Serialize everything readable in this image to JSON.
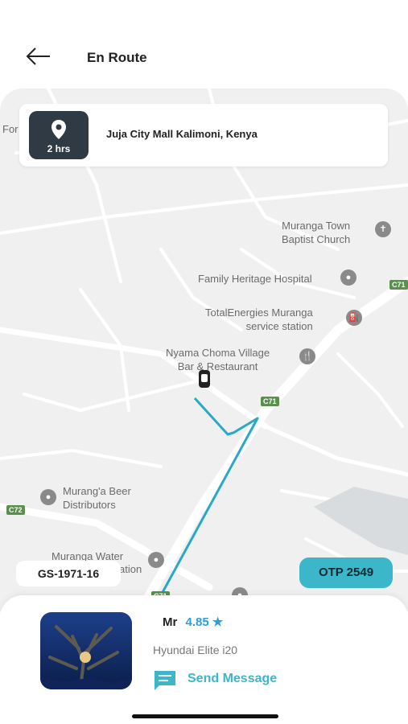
{
  "header": {
    "title": "En Route",
    "back_icon": "arrow-left-icon"
  },
  "destination": {
    "eta": "2 hrs",
    "address": "Juja City Mall Kalimoni, Kenya",
    "icon": "location-pin-icon"
  },
  "map": {
    "labels": {
      "for": "For",
      "baptist": "Muranga Town\nBaptist Church",
      "hospital": "Family Heritage Hospital",
      "total": "TotalEnergies Muranga\nservice station",
      "nyama": "Nyama Choma Village\nBar & Restaurant",
      "beer": "Murang'a Beer\nDistributors",
      "water": "Muranga Water",
      "water2": "ation"
    },
    "roads": {
      "c71_a": "C71",
      "c71_b": "C71",
      "c72": "C72",
      "c71_c": "C71"
    },
    "route_color": "#29a9c6"
  },
  "vehicle": {
    "plate": "GS-1971-16"
  },
  "otp": {
    "label": "OTP 2549"
  },
  "driver": {
    "title": "Mr",
    "rating": "4.85",
    "star": "★",
    "car": "Hyundai Elite i20",
    "send_message": "Send Message",
    "message_icon": "chat-icon"
  },
  "colors": {
    "accent": "#3cb6c9",
    "eta_bg": "#2f3a45",
    "rating": "#2b9fd8"
  }
}
